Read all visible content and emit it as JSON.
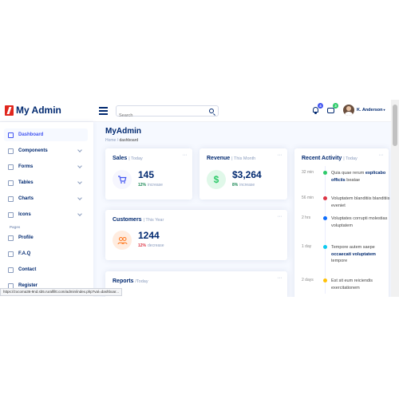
{
  "header": {
    "logo_text": "My Admin",
    "search_placeholder": "Search",
    "notifications_count": "4",
    "messages_count": "3",
    "user_name": "K. Anderson"
  },
  "sidebar": {
    "items": [
      {
        "label": "Dashboard",
        "icon": "grid-icon",
        "active": true
      },
      {
        "label": "Components",
        "icon": "menu-icon",
        "has_chevron": true
      },
      {
        "label": "Forms",
        "icon": "journal-icon",
        "has_chevron": true
      },
      {
        "label": "Tables",
        "icon": "layout-icon",
        "has_chevron": true
      },
      {
        "label": "Charts",
        "icon": "bar-chart-icon",
        "has_chevron": true
      },
      {
        "label": "Icons",
        "icon": "gem-icon",
        "has_chevron": true
      }
    ],
    "pages_heading": "Pages",
    "pages": [
      {
        "label": "Profile",
        "icon": "person-icon"
      },
      {
        "label": "F.A.Q",
        "icon": "question-icon"
      },
      {
        "label": "Contact",
        "icon": "envelope-icon"
      },
      {
        "label": "Register",
        "icon": "card-icon"
      }
    ]
  },
  "main": {
    "page_title": "MyAdmin",
    "breadcrumb": [
      "Home",
      "dashboard"
    ],
    "sales": {
      "title": "Sales",
      "period": "| Today",
      "value": "145",
      "pct": "12%",
      "note": "increase",
      "color": "#4154f1"
    },
    "revenue": {
      "title": "Revenue",
      "period": "| This Month",
      "value": "$3,264",
      "pct": "8%",
      "note": "increase",
      "color": "#2eca6a"
    },
    "customers": {
      "title": "Customers",
      "period": "| This Year",
      "value": "1244",
      "pct": "12%",
      "note": "decrease",
      "color": "#ff771d"
    },
    "reports": {
      "title": "Reports",
      "period": "/Today"
    }
  },
  "activity": {
    "title": "Recent Activity",
    "period": "| Today",
    "items": [
      {
        "time": "32 min",
        "color": "#2eca6a",
        "pre": "Quia quae rerum ",
        "bold": "explicabo officiis",
        "post": " beatae"
      },
      {
        "time": "56 min",
        "color": "#dc3545",
        "pre": "Voluptatem blanditiis blanditiis eveniet",
        "bold": "",
        "post": ""
      },
      {
        "time": "2 hrs",
        "color": "#0d6efd",
        "pre": "Voluptates corrupti molestias voluptatem",
        "bold": "",
        "post": ""
      },
      {
        "time": "1 day",
        "color": "#0dcaf0",
        "pre": "Tempore autem saepe ",
        "bold": "occaecati voluptatem",
        "post": " tempore"
      },
      {
        "time": "2 days",
        "color": "#ffc107",
        "pre": "Est sit eum reiciendis exercitationem",
        "bold": "",
        "post": ""
      }
    ]
  },
  "status_bar": {
    "url": "https://zocoma36-9nd.sb5.ruralfiltt.com/admin/index.php?val=dashboar..."
  }
}
